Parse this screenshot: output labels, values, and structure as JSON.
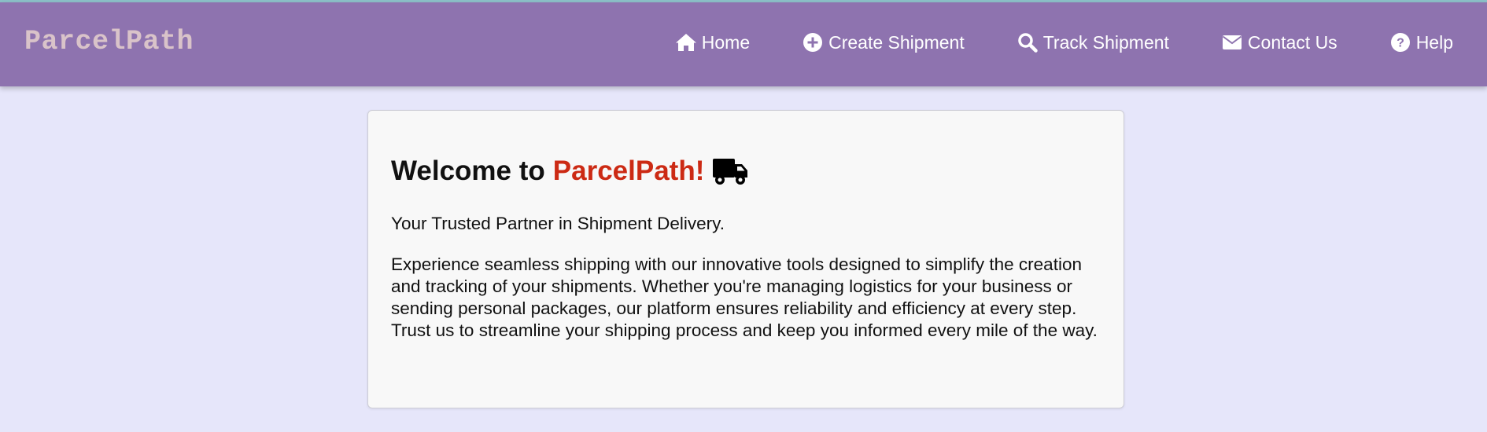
{
  "brand": {
    "name": "ParcelPath"
  },
  "nav": {
    "items": [
      {
        "label": "Home",
        "icon": "home-icon"
      },
      {
        "label": "Create Shipment",
        "icon": "plus-circle-icon"
      },
      {
        "label": "Track Shipment",
        "icon": "search-icon"
      },
      {
        "label": "Contact Us",
        "icon": "envelope-icon"
      },
      {
        "label": "Help",
        "icon": "question-circle-icon"
      }
    ]
  },
  "welcome": {
    "prefix": "Welcome to",
    "brand": "ParcelPath!",
    "icon": "truck-icon"
  },
  "tagline": "Your Trusted Partner in Shipment Delivery.",
  "description": "Experience seamless shipping with our innovative tools designed to simplify the creation and tracking of your shipments. Whether you're managing logistics for your business or sending personal packages, our platform ensures reliability and efficiency at every step. Trust us to streamline your shipping process and keep you informed every mile of the way.",
  "colors": {
    "page_background": "#e6e6fa",
    "navbar": "#8e73af",
    "brand_text": "#d9c3c9",
    "accent_red": "#cc2a14",
    "card_background": "#f8f8f8"
  }
}
